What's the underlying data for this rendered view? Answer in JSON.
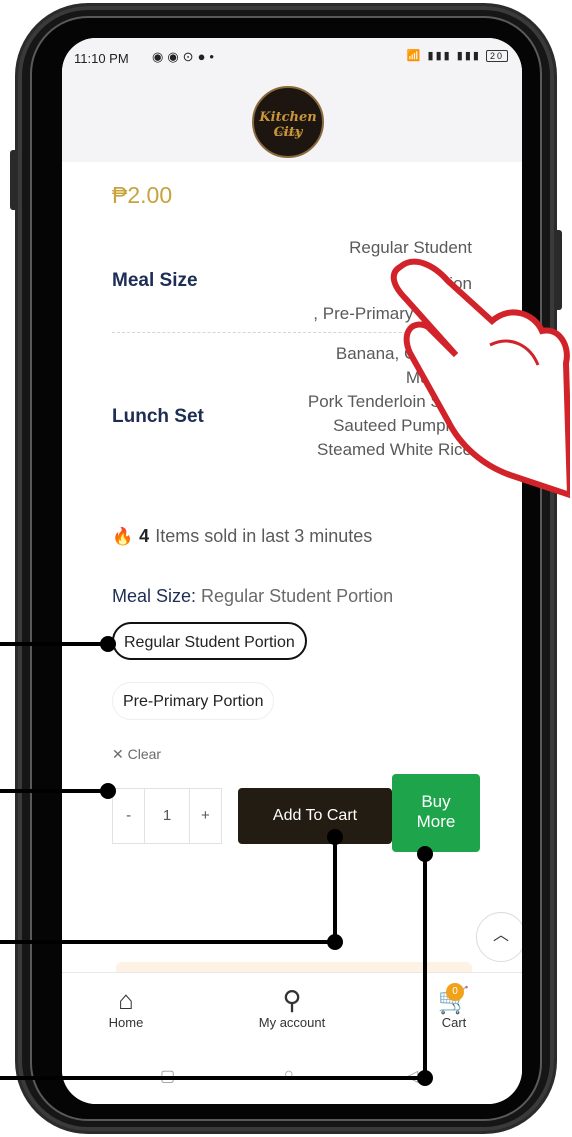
{
  "status_bar": {
    "time": "11:10 PM",
    "battery": "20"
  },
  "product": {
    "price": "₱2.00",
    "attributes": [
      {
        "label": "Meal Size",
        "value_lines": [
          "Regular Student",
          "Portion",
          ", Pre-Primary Portion"
        ]
      },
      {
        "label": "Lunch Set",
        "value_lines": [
          "Banana, Chayote,",
          "Mustard,",
          "Pork Tenderloin Stew,",
          "Sauteed Pumpkin,",
          "Steamed White Rice"
        ]
      }
    ],
    "sold_count": "4",
    "sold_text": "Items sold in last 3 minutes",
    "selection_label": "Meal Size",
    "selection_value": "Regular Student Portion",
    "options": [
      "Regular Student Portion",
      "Pre-Primary Portion"
    ],
    "clear_label": "Clear",
    "quantity": "1",
    "add_to_cart_label": "Add To Cart",
    "buy_more_label_1": "Buy",
    "buy_more_label_2": "More"
  },
  "bottom_nav": {
    "home": "Home",
    "account": "My account",
    "cart": "Cart",
    "cart_badge": "0"
  },
  "icons": [
    "flame-icon",
    "close-icon",
    "chevron-up-icon",
    "home-icon",
    "user-icon",
    "cart-icon",
    "pointing-hand-icon"
  ],
  "colors": {
    "price": "#c8a23c",
    "label_navy": "#1e2d55",
    "buy_more": "#1ea44a",
    "add_to_cart": "#221c12",
    "accent_orange": "#f2a21a"
  }
}
